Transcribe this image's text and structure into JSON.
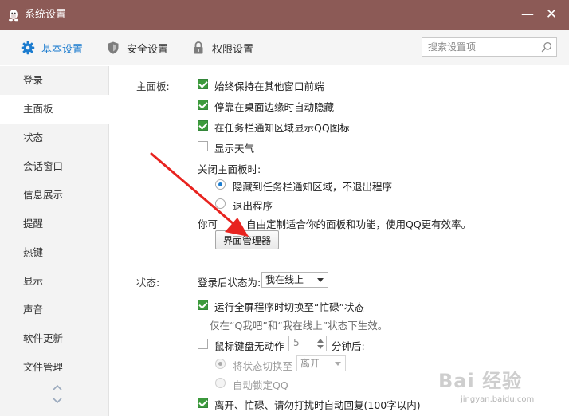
{
  "window": {
    "title": "系统设置",
    "min_glyph": "—",
    "close_glyph": "✕"
  },
  "tabs": [
    {
      "label": "基本设置",
      "active": true,
      "icon": "gear-icon"
    },
    {
      "label": "安全设置",
      "active": false,
      "icon": "shield-icon"
    },
    {
      "label": "权限设置",
      "active": false,
      "icon": "lock-icon"
    }
  ],
  "search": {
    "placeholder": "搜索设置项",
    "value": ""
  },
  "sidebar": {
    "items": [
      {
        "label": "登录",
        "active": false
      },
      {
        "label": "主面板",
        "active": true
      },
      {
        "label": "状态",
        "active": false
      },
      {
        "label": "会话窗口",
        "active": false
      },
      {
        "label": "信息展示",
        "active": false
      },
      {
        "label": "提醒",
        "active": false
      },
      {
        "label": "热键",
        "active": false
      },
      {
        "label": "显示",
        "active": false
      },
      {
        "label": "声音",
        "active": false
      },
      {
        "label": "软件更新",
        "active": false
      },
      {
        "label": "文件管理",
        "active": false
      }
    ]
  },
  "main_panel": {
    "label": "主面板:",
    "options": [
      {
        "label": "始终保持在其他窗口前端",
        "checked": true
      },
      {
        "label": "停靠在桌面边缘时自动隐藏",
        "checked": true
      },
      {
        "label": "在任务栏通知区域显示QQ图标",
        "checked": true
      },
      {
        "label": "显示天气",
        "checked": false
      }
    ],
    "close_label": "关闭主面板时:",
    "close_options": [
      {
        "label": "隐藏到任务栏通知区域，不退出程序",
        "checked": true
      },
      {
        "label": "退出程序",
        "checked": false
      }
    ],
    "hint_prefix": "你可",
    "hint_suffix": "自由定制适合你的面板和功能，使用QQ更有效率。",
    "manager_button": "界面管理器"
  },
  "status": {
    "label": "状态:",
    "after_login_label": "登录后状态为:",
    "after_login_value": "我在线上",
    "fullscreen_busy": {
      "label": "运行全屏程序时切换至“忙碌”状态",
      "checked": true
    },
    "fullscreen_note": "仅在“Q我吧”和“我在线上”状态下生效。",
    "idle": {
      "label": "鼠标键盘无动作",
      "checked": false,
      "minutes": "5",
      "suffix": "分钟后:"
    },
    "idle_switch": {
      "label": "将状态切换至",
      "checked": true,
      "value": "离开"
    },
    "idle_lock": {
      "label": "自动锁定QQ",
      "checked": false
    },
    "auto_reply": {
      "label": "离开、忙碌、请勿打扰时自动回复(100字以内)",
      "checked": true
    }
  },
  "watermark": {
    "text": "Bai 经验",
    "url": "jingyan.baidu.com"
  },
  "colors": {
    "titlebar": "#8c5a56",
    "accent": "#1c7ccf",
    "check": "#3c9a3c",
    "arrow": "#e8231f"
  }
}
